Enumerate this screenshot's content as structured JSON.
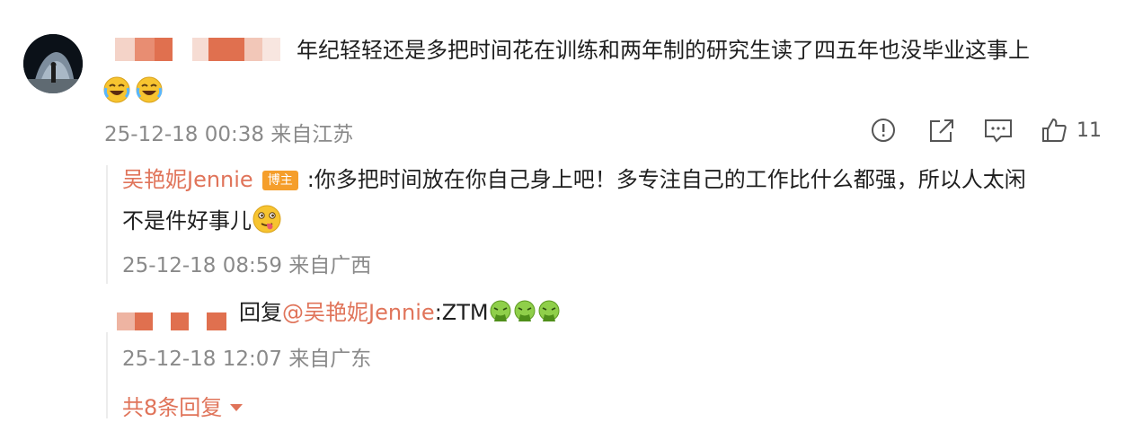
{
  "comment": {
    "text": "年纪轻轻还是多把时间花在训练和两年制的研究生读了四五年也没毕业这事上",
    "emoji_icons": [
      "laughing-crying-emoji",
      "laughing-crying-emoji"
    ],
    "timestamp": "25-12-18 00:38 来自江苏",
    "actions": {
      "report_icon": "exclamation-circle-icon",
      "share_icon": "share-icon",
      "comment_icon": "comment-icon",
      "like_icon": "thumbs-up-icon",
      "like_count": "11"
    }
  },
  "replies": [
    {
      "author": "吴艳妮Jennie",
      "badge": "博主",
      "text_line1": ":你多把时间放在你自己身上吧！多专注自己的工作比什么都强，所以人太闲",
      "text_line2": "不是件好事儿",
      "emoji_icon": "tongue-out-emoji",
      "timestamp": "25-12-18 08:59 来自广西"
    },
    {
      "prefix": "回复",
      "mention": "@吴艳妮Jennie",
      "text": ":ZTM",
      "emoji_icons": [
        "vomit-emoji",
        "vomit-emoji",
        "vomit-emoji"
      ],
      "timestamp": "25-12-18 12:07 来自广东"
    }
  ],
  "more_replies": {
    "label": "共8条回复",
    "icon": "caret-down-icon"
  },
  "colors": {
    "accent": "#e0745a",
    "meta_gray": "#8a8a8a",
    "badge": "#f59e2b"
  }
}
